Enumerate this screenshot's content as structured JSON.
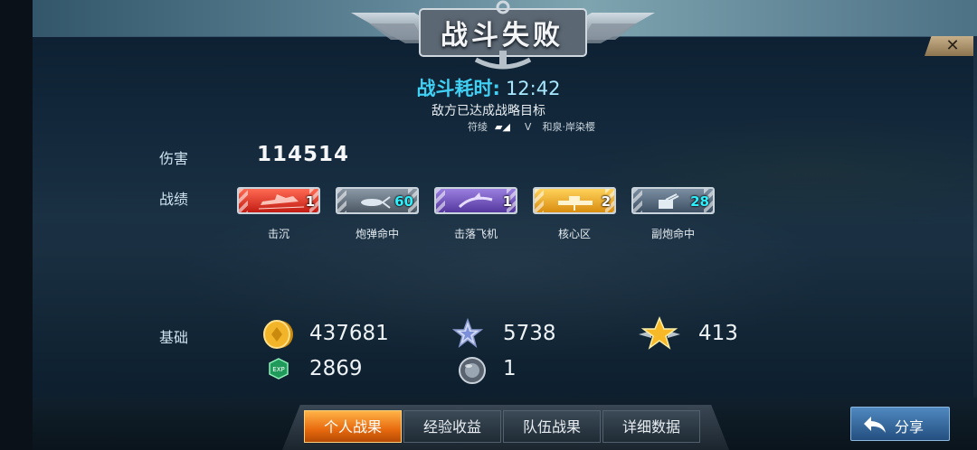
{
  "header": {
    "title": "战斗失败"
  },
  "battle": {
    "time_label": "战斗耗时:",
    "time_value": "12:42",
    "result_message": "敌方已达成战略目标",
    "player_left": "符绫",
    "vs": "V",
    "player_right": "和泉·岸染樱"
  },
  "stats": {
    "damage_label": "伤害",
    "damage_value": "114514",
    "record_label": "战绩",
    "medals": [
      {
        "label": "击沉",
        "count": "1",
        "color": "#e0342a",
        "icon": "ship-icon"
      },
      {
        "label": "炮弹命中",
        "count": "60",
        "color": "#6f7d8a",
        "icon": "shell-icon"
      },
      {
        "label": "击落飞机",
        "count": "1",
        "color": "#7a5ac8",
        "icon": "plane-icon"
      },
      {
        "label": "核心区",
        "count": "2",
        "color": "#f0a820",
        "icon": "core-icon"
      },
      {
        "label": "副炮命中",
        "count": "28",
        "color": "#5c6f84",
        "icon": "secondary-gun-icon"
      }
    ]
  },
  "base": {
    "label": "基础",
    "coins": "437681",
    "silver_star": "5738",
    "gold_star": "413",
    "exp": "2869",
    "orb": "1"
  },
  "tabs": [
    {
      "label": "个人战果",
      "active": true
    },
    {
      "label": "经验收益",
      "active": false
    },
    {
      "label": "队伍战果",
      "active": false
    },
    {
      "label": "详细数据",
      "active": false
    }
  ],
  "share": {
    "label": "分享"
  },
  "close": {
    "label": "✕"
  }
}
